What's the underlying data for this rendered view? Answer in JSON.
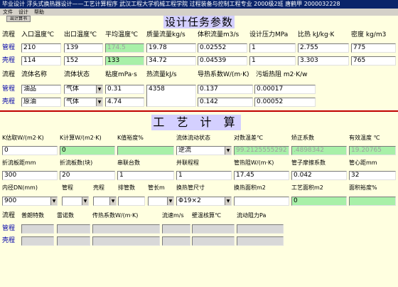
{
  "window_title": "毕业设计   浮头式换热器设计——工艺计算程序   武汉工程大学机械工程学院 过程装备与控制工程专业 2000级2班 唐鹤甲 2000032228",
  "menu": [
    "文件",
    "设计",
    "帮助"
  ],
  "calc_button": "出计算书",
  "section1_title": "设计任务参数",
  "section2_title": "工 艺 计 算",
  "t1": {
    "headers": [
      "流程",
      "入口温度℃",
      "出口温度℃",
      "平均温度℃",
      "质量流量kg/s",
      "体积流量m3/s",
      "设计压力MPa",
      "比热 kJ/kg·K",
      "密度 kg/m3"
    ],
    "row_labels": [
      "管程",
      "壳程"
    ],
    "rows": [
      [
        "210",
        "139",
        "174.5",
        "19.78",
        "0.02552",
        "1",
        "2.755",
        "775"
      ],
      [
        "114",
        "152",
        "133",
        "34.72",
        "0.04539",
        "1",
        "3.303",
        "765"
      ]
    ]
  },
  "t2": {
    "headers": [
      "流程",
      "流体名称",
      "流体状态",
      "粘度mPa·s",
      "热流量kJ/s",
      "导热系数W/(m·K)",
      "污垢热阻 m2·K/w"
    ],
    "row_labels": [
      "管程",
      "壳程"
    ],
    "names": [
      "油品",
      "原油"
    ],
    "states": [
      "气体",
      "气体"
    ],
    "viscosity": [
      "0.31",
      "4.74"
    ],
    "heat_flow": "4358",
    "conductivity": [
      "0.137",
      "0.142"
    ],
    "fouling": [
      "0.00017",
      "0.00052"
    ]
  },
  "p1": {
    "labels": [
      "K估取W/(m2·K)",
      "K计算W/(m2·K)",
      "K值裕度%",
      "流体流动状态",
      "对数温差℃",
      "矫正系数",
      "有效温度 ℃"
    ],
    "values": [
      "0",
      "0",
      "",
      "逆流",
      "99.2125555292",
      ".4898342",
      "19.20765"
    ]
  },
  "p2": {
    "labels": [
      "折流板距mm",
      "折流板数(块)",
      "串联台数",
      "并联程程",
      "管热阻W/(m·K)",
      "管子摩擦系数",
      "管心距mm"
    ],
    "values": [
      "300",
      "20",
      "1",
      "1",
      "17.45",
      "0.042",
      "32"
    ]
  },
  "p3": {
    "labels": [
      "内径DN(mm)",
      "管程",
      "壳程",
      "排管数",
      "管长m",
      "换热管尺寸",
      "换热面积m2",
      "工艺面积m2",
      "面积裕度%"
    ],
    "dn": "900",
    "tube_size": "Φ19×2",
    "area": "0"
  },
  "t3": {
    "headers": [
      "流程",
      "普朗特数",
      "雷诺数",
      "传热系数W/(m·K)",
      "流速m/s",
      "壁温核算℃",
      "流动阻力Pa"
    ],
    "row_labels": [
      "管程",
      "壳程"
    ]
  }
}
